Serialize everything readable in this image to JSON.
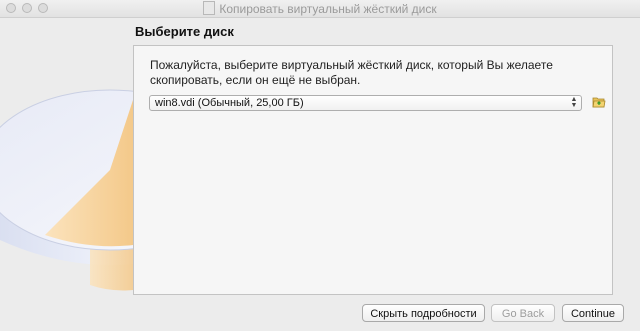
{
  "window": {
    "title": "Копировать виртуальный жёсткий диск"
  },
  "page": {
    "heading": "Выберите диск",
    "description": "Пожалуйста, выберите виртуальный жёсткий диск, который Вы желаете скопировать, если он ещё не выбран."
  },
  "disk_select": {
    "selected": "win8.vdi (Обычный, 25,00 ГБ)"
  },
  "icons": {
    "folder": "folder-open-icon",
    "document": "document-icon"
  },
  "buttons": {
    "hide_details": "Скрыть подробности",
    "back": "Go Back",
    "continue": "Continue"
  },
  "colors": {
    "background": "#ececec",
    "panel": "#f6f6f6",
    "pie_accent": "#f6cf98"
  }
}
